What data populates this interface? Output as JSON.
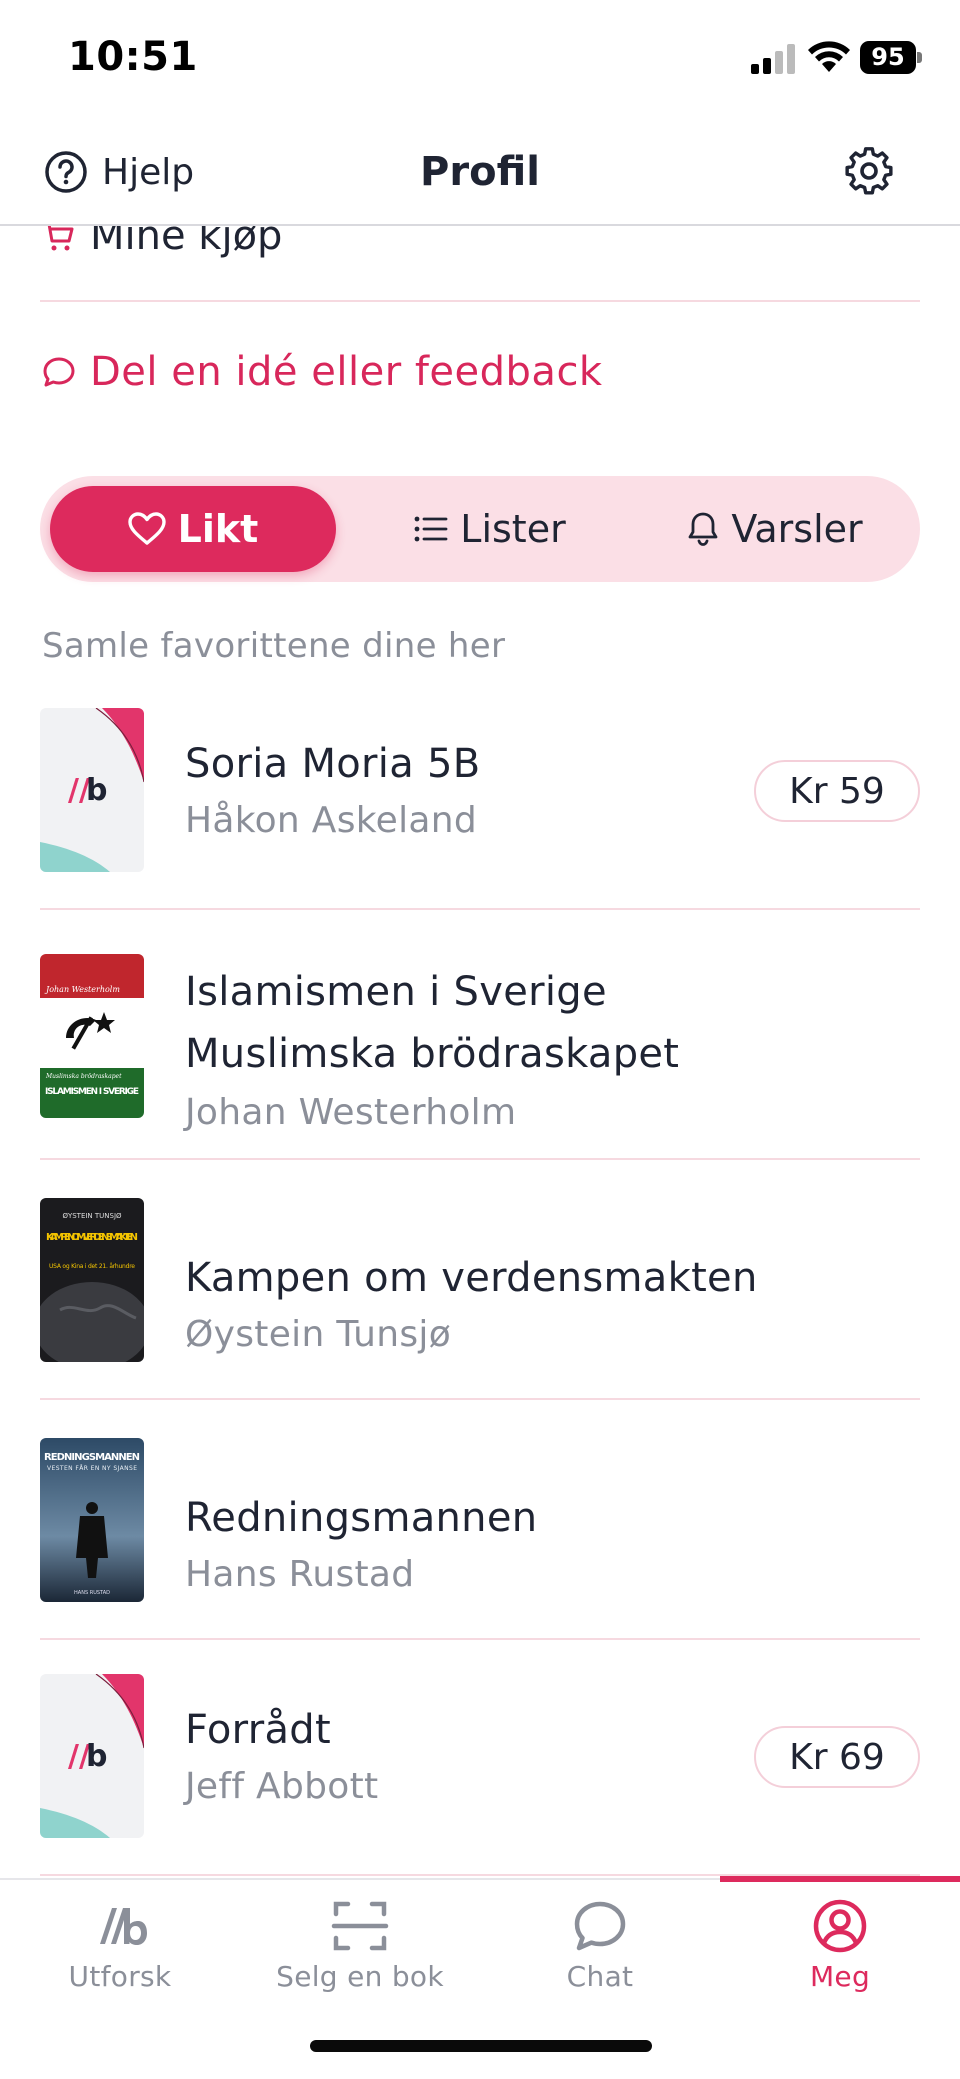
{
  "status_bar": {
    "time": "10:51",
    "battery": "95"
  },
  "header": {
    "help_label": "Hjelp",
    "title": "Profil"
  },
  "menu": {
    "purchases_label": "Mine kjøp",
    "feedback_label": "Del en idé eller feedback"
  },
  "segments": {
    "likt": "Likt",
    "lister": "Lister",
    "varsler": "Varsler",
    "selected": "Likt"
  },
  "hint": "Samle favorittene dine her",
  "books": [
    {
      "title": "Soria Moria 5B",
      "author": "Håkon Askeland",
      "price": "Kr 59",
      "cover": "placeholder"
    },
    {
      "title_line1": "Islamismen i Sverige",
      "title_line2": "Muslimska brödraskapet",
      "author": "Johan Westerholm",
      "cover": "photo",
      "cover_author": "Johan Westerholm",
      "cover_subtitle": "Muslimska brödraskapet",
      "cover_title": "ISLAMISMEN I SVERIGE"
    },
    {
      "title": "Kampen om verdensmakten",
      "author": "Øystein Tunsjø",
      "cover": "photo",
      "cover_author": "ØYSTEIN TUNSJØ",
      "cover_title": "KAMPEN OM VERDENSMAKTEN",
      "cover_subtitle": "USA og Kina i det 21. århundre"
    },
    {
      "title": "Redningsmannen",
      "author": "Hans Rustad",
      "cover": "photo",
      "cover_title": "REDNINGSMANNEN",
      "cover_subtitle": "VESTEN FÅR EN NY SJANSE",
      "cover_author": "HANS RUSTAD"
    },
    {
      "title": "Forrådt",
      "author": "Jeff Abbott",
      "price": "Kr 69",
      "cover": "placeholder"
    }
  ],
  "tabs": [
    {
      "label": "Utforsk",
      "icon": "logo-icon"
    },
    {
      "label": "Selg en bok",
      "icon": "scan-icon"
    },
    {
      "label": "Chat",
      "icon": "chat-icon"
    },
    {
      "label": "Meg",
      "icon": "profile-icon",
      "active": true
    }
  ],
  "colors": {
    "accent": "#dd2a5d",
    "segment_bg": "#fbdfe6",
    "muted_text": "#8b8f99",
    "text": "#1f2433"
  }
}
